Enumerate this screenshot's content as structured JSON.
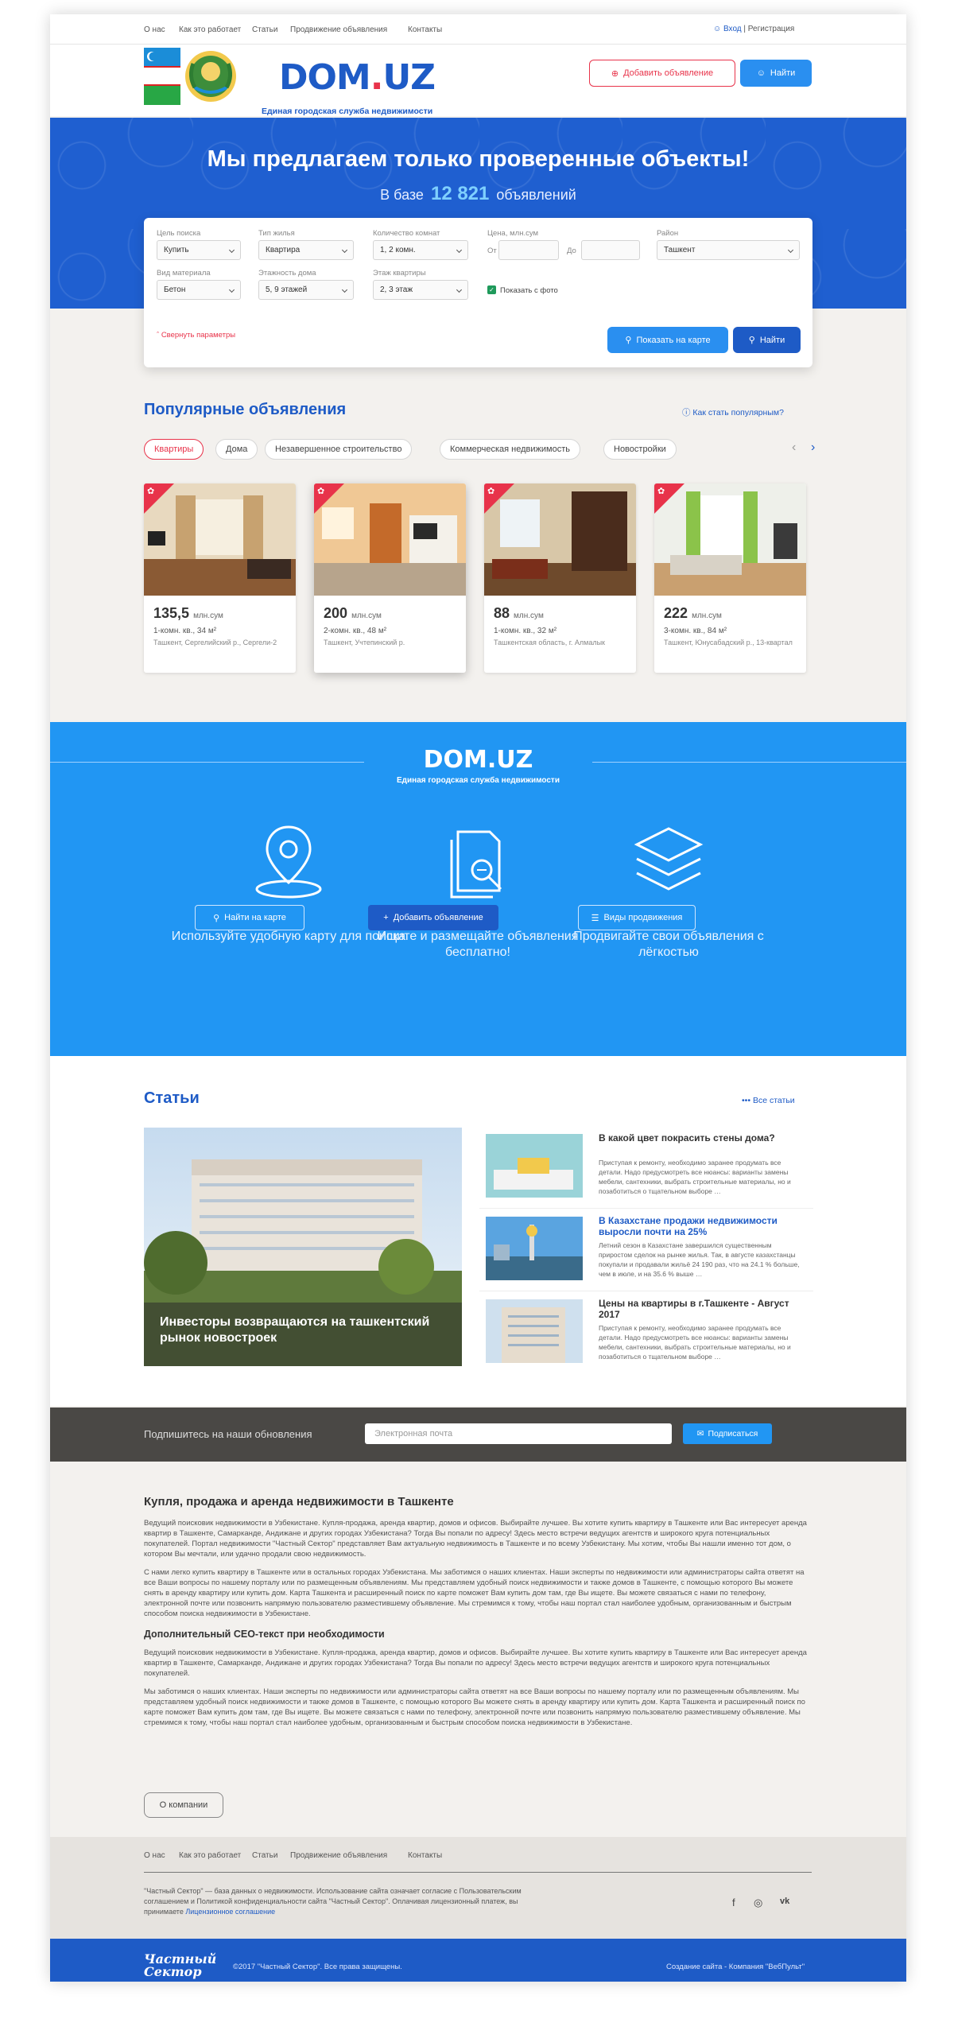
{
  "topnav": {
    "items": [
      "О нас",
      "Как это работает",
      "Статьи",
      "Продвижение объявления",
      "Контакты"
    ],
    "login": "Вход",
    "separator": "|",
    "register": "Регистрация"
  },
  "header": {
    "logo_main": "DOM",
    "logo_dot": ".",
    "logo_tld": "UZ",
    "logo_sub": "Единая городская служба недвижимости",
    "add_button": "Добавить объявление",
    "find_button": "Найти"
  },
  "hero": {
    "title": "Мы предлагаем только проверенные объекты!",
    "sub_prefix": "В базе",
    "count": "12 821",
    "sub_suffix": "объявлений"
  },
  "search": {
    "fields": {
      "goal": {
        "label": "Цель поиска",
        "value": "Купить"
      },
      "type": {
        "label": "Тип жилья",
        "value": "Квартира"
      },
      "rooms": {
        "label": "Количество комнат",
        "value": "1, 2 комн."
      },
      "price": {
        "label": "Цена, млн.сум",
        "from": "От",
        "to": "До"
      },
      "region": {
        "label": "Район",
        "value": "Ташкент"
      },
      "material": {
        "label": "Вид материала",
        "value": "Бетон"
      },
      "floors": {
        "label": "Этажность дома",
        "value": "5, 9 этажей"
      },
      "floor": {
        "label": "Этаж квартиры",
        "value": "2, 3 этаж"
      }
    },
    "photo_check": "Показать с фото",
    "collapse": "Свернуть параметры",
    "map_button": "Показать на карте",
    "find_button": "Найти"
  },
  "popular": {
    "title": "Популярные объявления",
    "how": "Как стать популярным?",
    "tabs": [
      "Квартиры",
      "Дома",
      "Незавершенное строительство",
      "Коммерческая недвижимость",
      "Новостройки"
    ],
    "cards": [
      {
        "price": "135,5",
        "unit": "млн.сум",
        "desc": "1-комн. кв., 34 м²",
        "addr": "Ташкент, Сергелийский р., Сергели-2"
      },
      {
        "price": "200",
        "unit": "млн.сум",
        "desc": "2-комн. кв., 48 м²",
        "addr": "Ташкент, Учтепинский р."
      },
      {
        "price": "88",
        "unit": "млн.сум",
        "desc": "1-комн. кв., 32 м²",
        "addr": "Ташкентская область, г. Алмалык"
      },
      {
        "price": "222",
        "unit": "млн.сум",
        "desc": "3-комн. кв., 84 м²",
        "addr": "Ташкент, Юнусабадский р., 13-квартал"
      }
    ]
  },
  "promo": {
    "logo": "DOM.UZ",
    "logo_sub": "Единая городская служба недвижимости",
    "cols": [
      {
        "title": "Используйте удобную карту для поиска",
        "button": "Найти на карте"
      },
      {
        "title": "Ищите и размещайте объявления бесплатно!",
        "button": "Добавить объявление"
      },
      {
        "title": "Продвигайте свои объявления с лёгкостью",
        "button": "Виды продвижения"
      }
    ]
  },
  "articles": {
    "title": "Статьи",
    "all": "Все статьи",
    "big_caption": "Инвесторы возвращаются на ташкентский рынок новостроек",
    "items": [
      {
        "title": "В какой цвет покрасить стены дома?",
        "text": "Приступая к ремонту, необходимо заранее продумать все детали. Надо предусмотреть все нюансы: варианты замены мебели, сантехники, выбрать строительные материалы, но и позаботиться о тщательном выборе …"
      },
      {
        "title": "В Казахстане продажи недвижимости выросли почти на 25%",
        "text": "Летний сезон в Казахстане завершился существенным приростом сделок на рынке жилья. Так, в августе казахстанцы покупали и продавали жильё 24 190 раз, что на 24.1 % больше, чем в июле, и на 35.6 % выше …"
      },
      {
        "title": "Цены на квартиры в г.Ташкенте - Август 2017",
        "text": "Приступая к ремонту, необходимо заранее продумать все детали. Надо предусмотреть все нюансы: варианты замены мебели, сантехники, выбрать строительные материалы, но и позаботиться о тщательном выборе …"
      }
    ]
  },
  "subscribe": {
    "label": "Подпишитесь на наши обновления",
    "placeholder": "Электронная почта",
    "button": "Подписаться"
  },
  "seo": {
    "title": "Купля, продажа и аренда недвижимости в Ташкенте",
    "p1": "Ведущий поисковик недвижимости в Узбекистане. Купля-продажа, аренда квартир, домов и офисов. Выбирайте лучшее. Вы хотите купить квартиру в Ташкенте или Вас интересует аренда квартир в Ташкенте, Самарканде, Андижане и других городах Узбекистана? Тогда Вы попали по адресу! Здесь место встречи ведущих агентств и широкого круга потенциальных покупателей. Портал недвижимости \"Частный Сектор\" представляет Вам актуальную недвижимость в Ташкенте и по всему Узбекистану. Мы хотим, чтобы Вы нашли именно тот дом, о котором Вы мечтали, или удачно продали свою недвижимость.",
    "p2": "С нами легко купить квартиру в Ташкенте или в остальных городах Узбекистана. Мы заботимся о наших клиентах. Наши эксперты по недвижимости или администраторы сайта ответят на все Ваши вопросы по нашему порталу или по размещенным объявлениям. Мы представляем удобный поиск недвижимости и также домов в Ташкенте, с помощью которого Вы можете снять в аренду квартиру или купить дом. Карта Ташкента и расширенный поиск по карте поможет Вам купить дом там, где Вы ищете. Вы можете связаться с нами по телефону, электронной почте или позвонить напрямую пользователю разместившему объявление. Мы стремимся к тому, чтобы наш портал стал наиболее удобным, организованным и быстрым способом поиска недвижимости в Узбекистане.",
    "subtitle": "Дополнительный СЕО-текст при необходимости",
    "p3": "Ведущий поисковик недвижимости в Узбекистане. Купля-продажа, аренда квартир, домов и офисов. Выбирайте лучшее. Вы хотите купить квартиру в Ташкенте или Вас интересует аренда квартир в Ташкенте, Самарканде, Андижане и других городах Узбекистана? Тогда Вы попали по адресу! Здесь место встречи ведущих агентств и широкого круга потенциальных покупателей.",
    "p4": "Мы заботимся о наших клиентах. Наши эксперты по недвижимости или администраторы сайта ответят на все Ваши вопросы по нашему порталу или по размещенным объявлениям. Мы представляем удобный поиск недвижимости и также домов в Ташкенте, с помощью которого Вы можете снять в аренду квартиру или купить дом. Карта Ташкента и расширенный поиск по карте поможет Вам купить дом там, где Вы ищете. Вы можете связаться с нами по телефону, электронной почте или позвонить напрямую пользователю разместившему объявление. Мы стремимся к тому, чтобы наш портал стал наиболее удобным, организованным и быстрым способом поиска недвижимости в Узбекистане.",
    "about_button": "О компании"
  },
  "footer": {
    "nav": [
      "О нас",
      "Как это работает",
      "Статьи",
      "Продвижение объявления",
      "Контакты"
    ],
    "text": "\"Частный Сектор\" — база данных о недвижимости. Использование сайта означает согласие с Пользовательским соглашением и Политикой конфиденциальности сайта \"Частный Сектор\". Оплачивая лицензионный платеж, вы принимаете",
    "link": "Лицензионное соглашение",
    "social": [
      "f",
      "◎",
      "vk"
    ],
    "brand_line1": "Частный",
    "brand_line2": "Сектор",
    "copyright": "©2017 \"Частный Сектор\". Все права защищены.",
    "developer": "Создание сайта - Компания \"ВебПульт\""
  },
  "colors": {
    "brand_blue": "#1e5bc6",
    "accent_red": "#e8334a",
    "light_blue": "#2196f3"
  }
}
